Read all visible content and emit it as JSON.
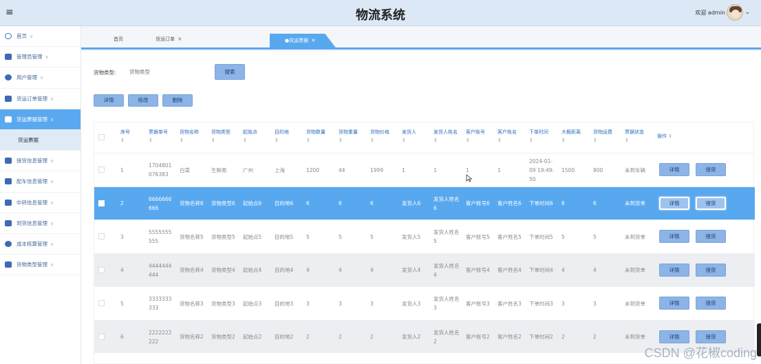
{
  "header": {
    "title": "物流系统",
    "welcome": "欢迎 admin",
    "menu_icon": "hamburger-icon"
  },
  "sidebar": {
    "items": [
      {
        "label": "首页",
        "icon": "home-icon"
      },
      {
        "label": "管理员管理",
        "icon": "admin-icon"
      },
      {
        "label": "用户管理",
        "icon": "user-icon"
      },
      {
        "label": "货运订单管理",
        "icon": "order-icon"
      },
      {
        "label": "货运票据管理",
        "icon": "bill-icon",
        "active": true
      },
      {
        "label": "货运票据",
        "sub": true
      },
      {
        "label": "接货信息管理",
        "icon": "receive-icon"
      },
      {
        "label": "配车信息管理",
        "icon": "truck-icon"
      },
      {
        "label": "中转信息管理",
        "icon": "transfer-icon"
      },
      {
        "label": "到货信息管理",
        "icon": "arrival-icon"
      },
      {
        "label": "成本核算管理",
        "icon": "cost-icon"
      },
      {
        "label": "货物类型管理",
        "icon": "category-icon"
      }
    ]
  },
  "tabs": [
    {
      "label": "首页",
      "closable": false
    },
    {
      "label": "货运订单",
      "closable": true
    },
    {
      "label": "●货运票据",
      "closable": true,
      "active": true
    }
  ],
  "search": {
    "label": "货物类型:",
    "placeholder": "货物类型",
    "button": "搜索"
  },
  "actions": {
    "detail": "详情",
    "edit": "修改",
    "delete": "删除"
  },
  "table": {
    "headers": [
      "序号",
      "票据单号",
      "货物名称",
      "货物类型",
      "起始点",
      "目的地",
      "货物数量",
      "货物重量",
      "货物价格",
      "发货人",
      "发货人姓名",
      "客户账号",
      "客户姓名",
      "下单时间",
      "大概距离",
      "货物运费",
      "票据状态",
      "操作"
    ],
    "rows": [
      {
        "no": "1",
        "bill": "1704801076383",
        "name": "白菜",
        "type": "生鲜类",
        "from": "广州",
        "to": "上海",
        "qty": "1200",
        "weight": "44",
        "price": "1999",
        "sender": "1",
        "sender_name": "1",
        "account": "1",
        "cust_name": "1",
        "time": "2024-01-09 19:49:50",
        "distance": "1500",
        "freight": "800",
        "status": "未到车辆"
      },
      {
        "no": "2",
        "bill": "6666666666",
        "name": "货物名称6",
        "type": "货物类型6",
        "from": "起始点6",
        "to": "目的地6",
        "qty": "6",
        "weight": "6",
        "price": "6",
        "sender": "发货人6",
        "sender_name": "发货人姓名6",
        "account": "客户账号6",
        "cust_name": "客户姓名6",
        "time": "下单时间6",
        "distance": "6",
        "freight": "6",
        "status": "未到货单",
        "selected": true
      },
      {
        "no": "3",
        "bill": "5555555555",
        "name": "货物名称5",
        "type": "货物类型5",
        "from": "起始点5",
        "to": "目的地5",
        "qty": "5",
        "weight": "5",
        "price": "5",
        "sender": "发货人5",
        "sender_name": "发货人姓名5",
        "account": "客户账号5",
        "cust_name": "客户姓名5",
        "time": "下单时间5",
        "distance": "5",
        "freight": "5",
        "status": "未到货单"
      },
      {
        "no": "4",
        "bill": "4444444444",
        "name": "货物名称4",
        "type": "货物类型4",
        "from": "起始点4",
        "to": "目的地4",
        "qty": "4",
        "weight": "4",
        "price": "4",
        "sender": "发货人4",
        "sender_name": "发货人姓名4",
        "account": "客户账号4",
        "cust_name": "客户姓名4",
        "time": "下单时间4",
        "distance": "4",
        "freight": "4",
        "status": "未到货单"
      },
      {
        "no": "5",
        "bill": "3333333333",
        "name": "货物名称3",
        "type": "货物类型3",
        "from": "起始点3",
        "to": "目的地3",
        "qty": "3",
        "weight": "3",
        "price": "3",
        "sender": "发货人3",
        "sender_name": "发货人姓名3",
        "account": "客户账号3",
        "cust_name": "客户姓名3",
        "time": "下单时间3",
        "distance": "3",
        "freight": "3",
        "status": "未到货单"
      },
      {
        "no": "6",
        "bill": "2222222222",
        "name": "货物名称2",
        "type": "货物类型2",
        "from": "起始点2",
        "to": "目的地2",
        "qty": "2",
        "weight": "2",
        "price": "2",
        "sender": "发货人2",
        "sender_name": "发货人姓名2",
        "account": "客户账号2",
        "cust_name": "客户姓名2",
        "time": "下单时间2",
        "distance": "2",
        "freight": "2",
        "status": "未到货单"
      }
    ],
    "row_buttons": {
      "detail": "详情",
      "receive": "接货"
    }
  },
  "watermark": "CSDN @花椒coding"
}
